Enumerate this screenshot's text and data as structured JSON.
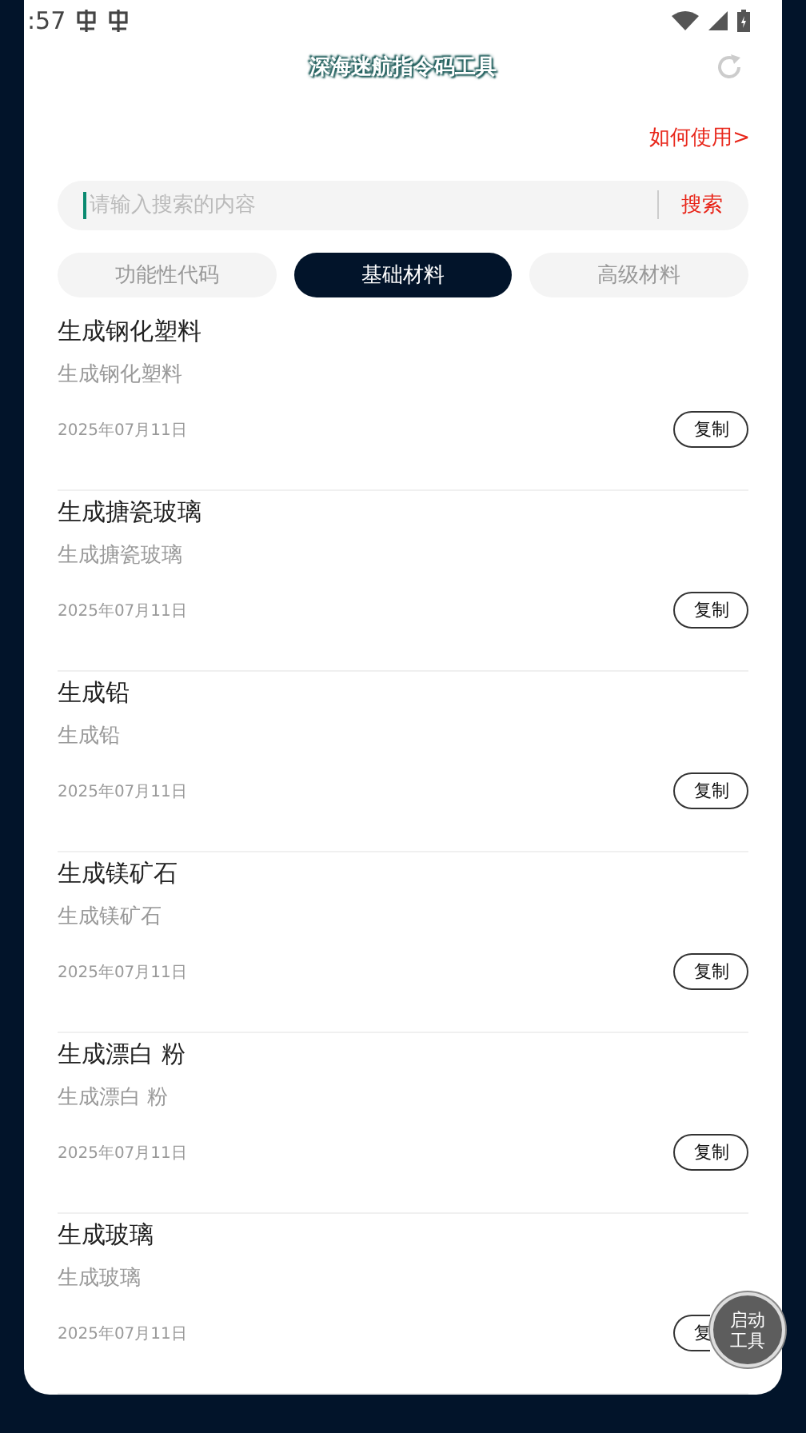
{
  "status_bar": {
    "time": ":57"
  },
  "header": {
    "title": "深海迷航指令码工具"
  },
  "help_link": "如何使用>",
  "search": {
    "placeholder": "请输入搜索的内容",
    "button": "搜索"
  },
  "tabs": [
    {
      "label": "功能性代码",
      "selected": false
    },
    {
      "label": "基础材料",
      "selected": true
    },
    {
      "label": "高级材料",
      "selected": false
    }
  ],
  "items": [
    {
      "title": "生成钢化塑料",
      "subtitle": "生成钢化塑料",
      "date": "2025年07月11日",
      "button": "复制"
    },
    {
      "title": "生成搪瓷玻璃",
      "subtitle": "生成搪瓷玻璃",
      "date": "2025年07月11日",
      "button": "复制"
    },
    {
      "title": "生成铅",
      "subtitle": "生成铅",
      "date": "2025年07月11日",
      "button": "复制"
    },
    {
      "title": "生成镁矿石",
      "subtitle": "生成镁矿石",
      "date": "2025年07月11日",
      "button": "复制"
    },
    {
      "title": "生成漂白 粉",
      "subtitle": "生成漂白 粉",
      "date": "2025年07月11日",
      "button": "复制"
    },
    {
      "title": "生成玻璃",
      "subtitle": "生成玻璃",
      "date": "2025年07月11日",
      "button": "复"
    }
  ],
  "fab": {
    "label": "启动工具"
  }
}
